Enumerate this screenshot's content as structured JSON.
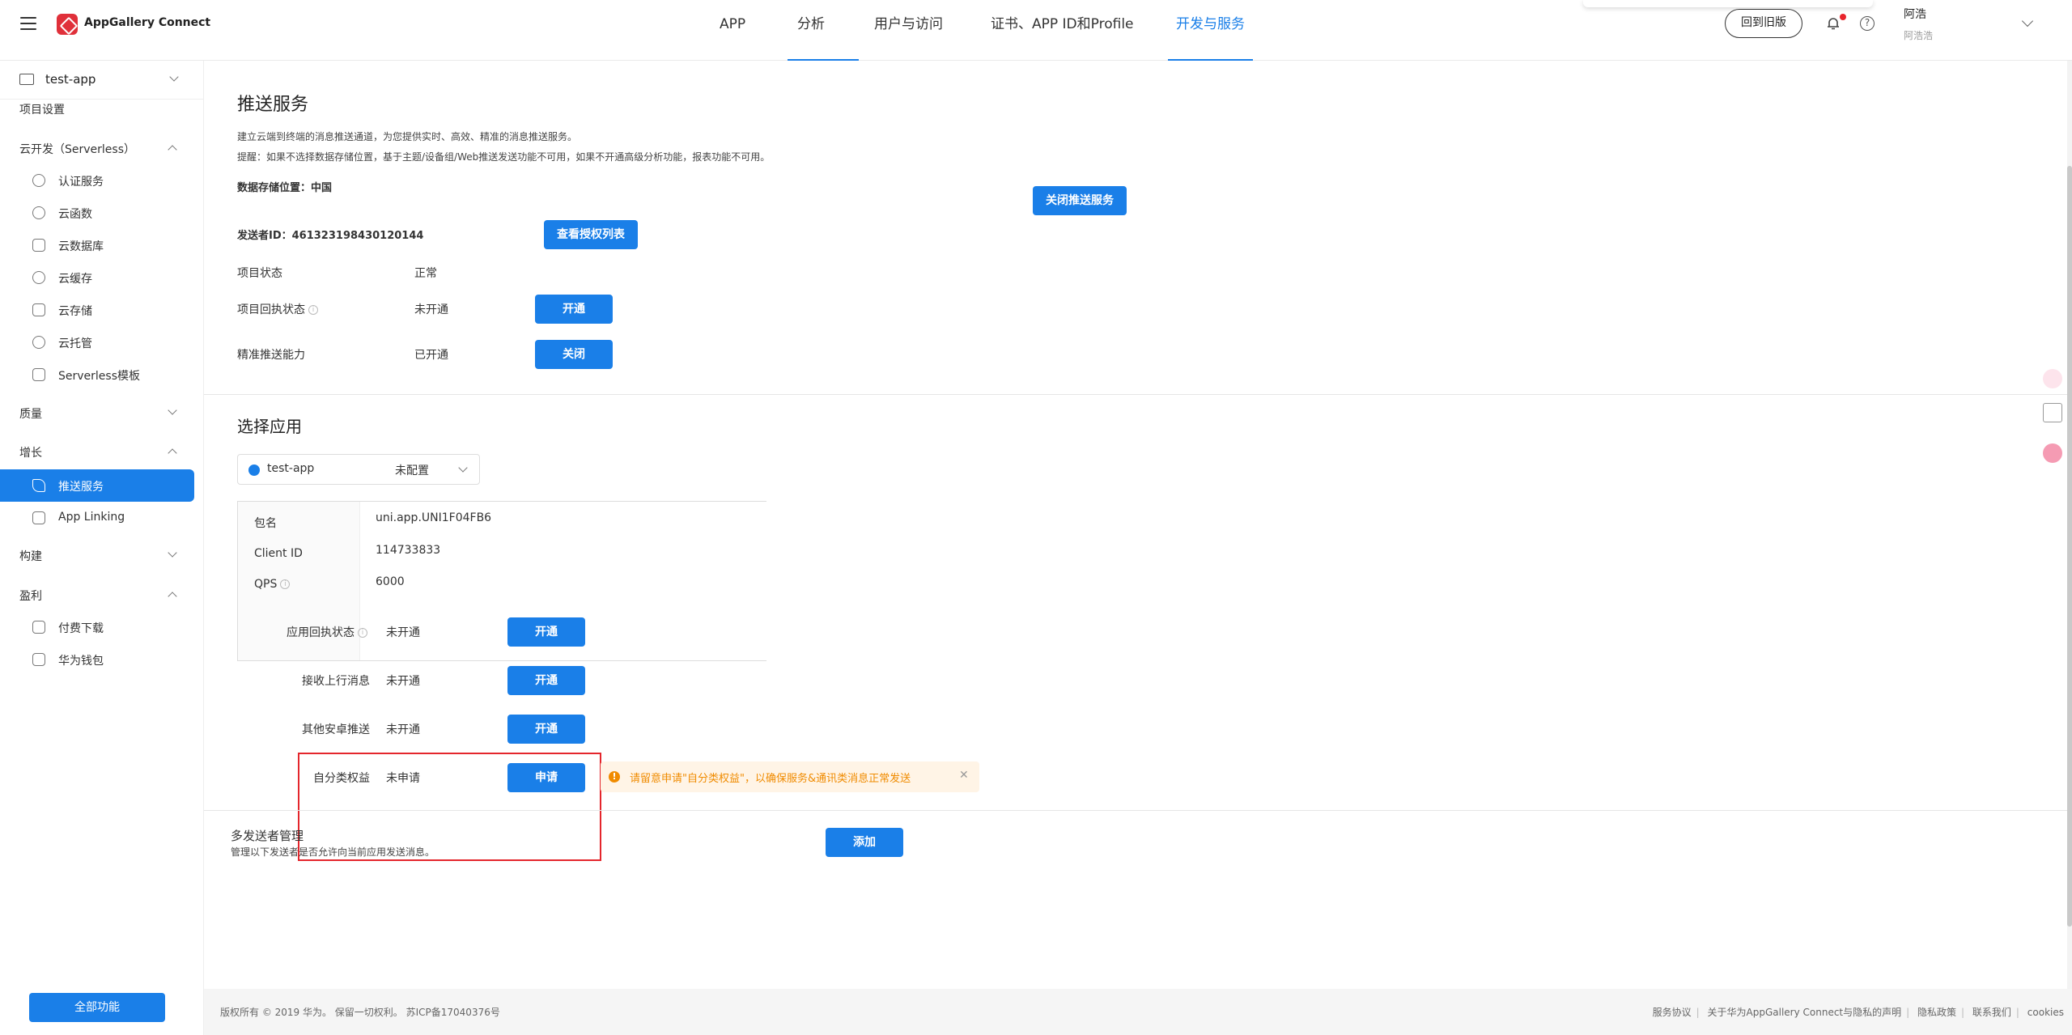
{
  "brand": "AppGallery Connect",
  "nav": [
    "APP",
    "分析",
    "用户与访问",
    "证书、APP ID和Profile",
    "开发与服务"
  ],
  "header": {
    "old_version": "回到旧版",
    "user_name": "阿浩",
    "user_sub": "阿浩浩"
  },
  "sidebar": {
    "project": "test-app",
    "project_settings": "项目设置",
    "serverless": "云开发（Serverless）",
    "serverless_items": [
      "认证服务",
      "云函数",
      "云数据库",
      "云缓存",
      "云存储",
      "云托管",
      "Serverless模板"
    ],
    "quality": "质量",
    "growth": "增长",
    "growth_items": [
      "推送服务",
      "App Linking"
    ],
    "build": "构建",
    "earn": "盈利",
    "earn_items": [
      "付费下载",
      "华为钱包"
    ],
    "all_features": "全部功能"
  },
  "push": {
    "title": "推送服务",
    "desc1": "建立云端到终端的消息推送通道，为您提供实时、高效、精准的消息推送服务。",
    "desc2": "提醒：如果不选择数据存储位置，基于主题/设备组/Web推送发送功能不可用，如果不开通高级分析功能，报表功能不可用。",
    "storage": "数据存储位置：中国",
    "close_btn": "关闭推送服务",
    "sender_id": "发送者ID：461323198430120144",
    "view_auth": "查看授权列表",
    "project_status_label": "项目状态",
    "project_status_value": "正常",
    "receipt_label": "项目回执状态",
    "receipt_value": "未开通",
    "receipt_btn": "开通",
    "precise_label": "精准推送能力",
    "precise_value": "已开通",
    "precise_btn": "关闭"
  },
  "select_app": {
    "title": "选择应用",
    "app_name": "test-app",
    "app_status": "未配置",
    "package_label": "包名",
    "package_value": "uni.app.UNI1F04FB6",
    "client_label": "Client ID",
    "client_value": "114733833",
    "qps_label": "QPS",
    "qps_value": "6000",
    "rows": [
      {
        "label": "应用回执状态",
        "value": "未开通",
        "btn": "开通"
      },
      {
        "label": "接收上行消息",
        "value": "未开通",
        "btn": "开通"
      },
      {
        "label": "其他安卓推送",
        "value": "未开通",
        "btn": "开通"
      },
      {
        "label": "自分类权益",
        "value": "未申请",
        "btn": "申请"
      }
    ],
    "notice": "请留意申请\"自分类权益\"，以确保服务&通讯类消息正常发送"
  },
  "multi_sender": {
    "title": "多发送者管理",
    "desc": "管理以下发送者是否允许向当前应用发送消息。",
    "add_btn": "添加"
  },
  "footer": {
    "copyright": "版权所有 © 2019 华为。 保留一切权利。 苏ICP备17040376号",
    "links": [
      "服务协议",
      "关于华为AppGallery Connect与隐私的声明",
      "隐私政策",
      "联系我们",
      "cookies"
    ]
  }
}
